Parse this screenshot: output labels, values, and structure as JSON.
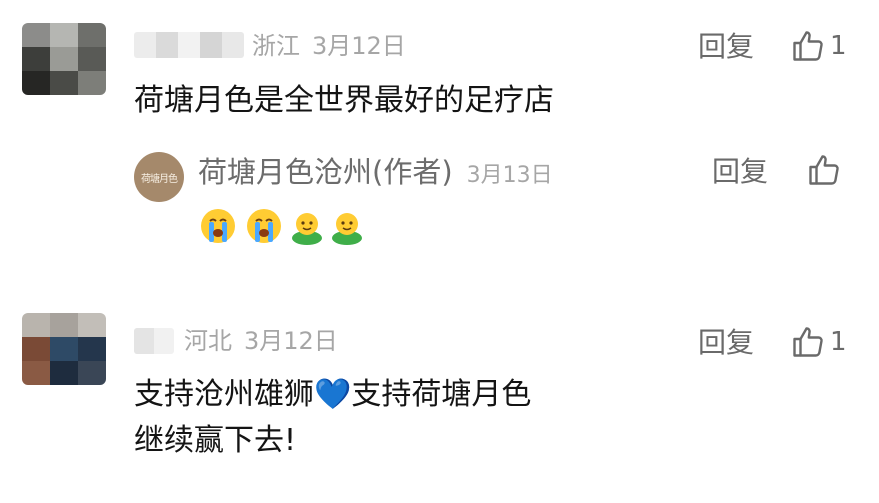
{
  "comments": [
    {
      "location": "浙江",
      "date": "3月12日",
      "text": "荷塘月色是全世界最好的足疗店",
      "reply_label": "回复",
      "like_count": "1",
      "reply": {
        "author": "荷塘月色沧州(作者)",
        "date": "3月13日",
        "reply_label": "回复",
        "logo_text": "荷塘月色",
        "emojis": [
          "crying-face",
          "crying-face",
          "smiling-green-figure",
          "smiling-green-figure"
        ]
      }
    },
    {
      "location": "河北",
      "date": "3月12日",
      "text_line1": "支持沧州雄狮💙支持荷塘月色",
      "text_line2": "继续赢下去!",
      "reply_label": "回复",
      "like_count": "1"
    }
  ],
  "icons": {
    "like": "thumbs-up-icon"
  },
  "colors": {
    "text": "#141414",
    "meta": "#a6a6a6",
    "action": "#6a6a6a",
    "logo": "#a5896b"
  }
}
